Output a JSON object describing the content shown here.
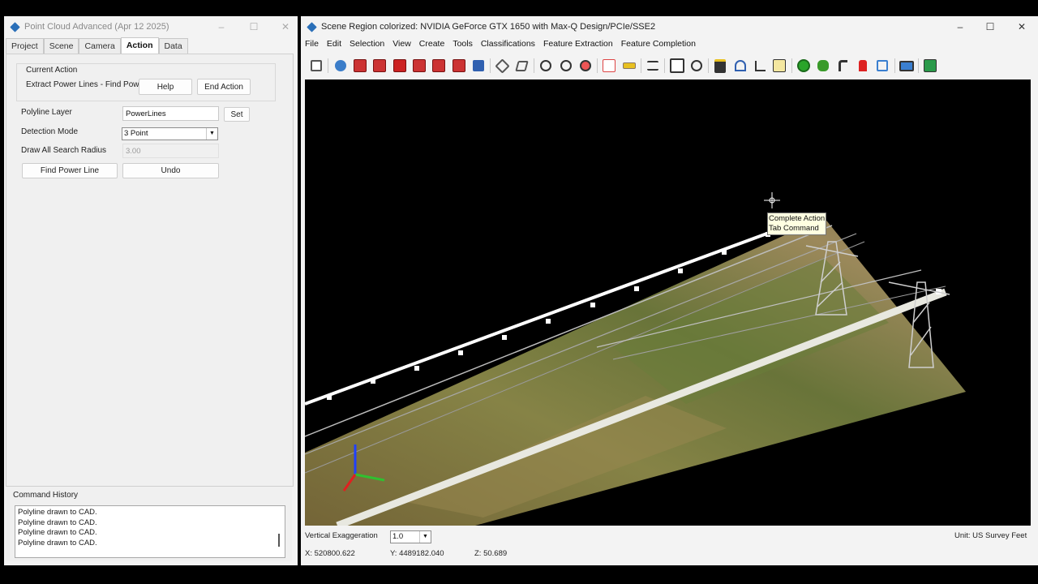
{
  "left_window": {
    "title": "Point Cloud Advanced (Apr 12 2025)",
    "tabs": [
      "Project",
      "Scene",
      "Camera",
      "Action",
      "Data"
    ],
    "active_tab": "Action",
    "current_action": {
      "group_label": "Current Action",
      "action_name": "Extract Power Lines - Find Power",
      "help_label": "Help",
      "end_action_label": "End Action"
    },
    "polyline_layer": {
      "label": "Polyline Layer",
      "value": "PowerLines",
      "set_label": "Set"
    },
    "detection_mode": {
      "label": "Detection Mode",
      "value": "3 Point"
    },
    "search_radius": {
      "label": "Draw All Search Radius",
      "value": "3.00"
    },
    "find_power_line_label": "Find Power Line",
    "undo_label": "Undo",
    "command_history": {
      "label": "Command History",
      "entries": [
        "Polyline drawn to CAD.",
        "Polyline drawn to CAD.",
        "Polyline drawn to CAD.",
        "Polyline drawn to CAD."
      ]
    }
  },
  "right_window": {
    "title": "Scene Region colorized: NVIDIA GeForce GTX 1650 with Max-Q Design/PCIe/SSE2",
    "menu": [
      "File",
      "Edit",
      "Selection",
      "View",
      "Create",
      "Tools",
      "Classifications",
      "Feature Extraction",
      "Feature Completion"
    ],
    "tooltip": {
      "line1": "Complete Action",
      "line2": "Tab Command"
    },
    "vertical_exaggeration": {
      "label": "Vertical Exaggeration",
      "value": "1.0"
    },
    "unit": "Unit:  US Survey Feet",
    "coords": {
      "x": "X: 520800.622",
      "y": "Y: 4489182.040",
      "z": "Z: 50.689"
    }
  },
  "icons": {
    "window_controls": [
      "minimize-icon",
      "maximize-icon",
      "close-icon"
    ],
    "toolbar": [
      "layout-icon",
      "refresh-icon",
      "view-cube-front-icon",
      "view-cube-side-icon",
      "view-cube-top-icon",
      "view-cube-back-icon",
      "view-cube-left-icon",
      "view-cube-right-icon",
      "person-icon",
      "rotate-icon",
      "select-icon",
      "zoom-window-icon",
      "zoom-extents-icon",
      "zoom-out-icon",
      "pdf-icon",
      "measure-icon",
      "layers-icon",
      "find-icon",
      "inspect-icon",
      "bulldozer-icon",
      "tunnel-icon",
      "profile-chart-icon",
      "edit-chart-icon",
      "green-circle-icon",
      "tree-icon",
      "pole-icon",
      "hydrant-icon",
      "frame-icon",
      "monitor-icon",
      "exit-icon"
    ]
  },
  "colors": {
    "accent": "#2a6fb8",
    "tab_active_text": "#111111",
    "tooltip_bg": "#ffffe1"
  }
}
